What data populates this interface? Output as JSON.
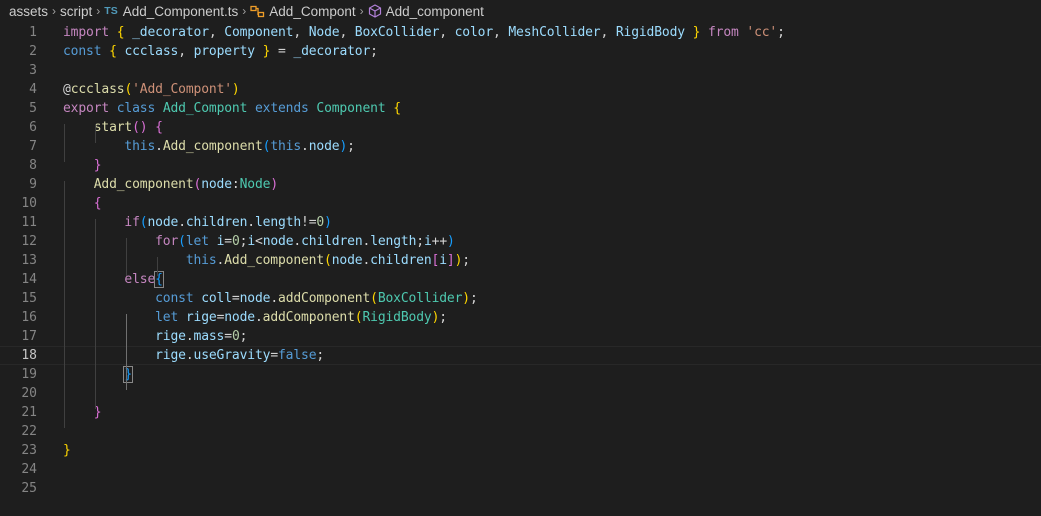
{
  "breadcrumb": {
    "items": [
      "assets",
      "script",
      "Add_Component.ts",
      "Add_Compont",
      "Add_component"
    ],
    "file_badge": "TS"
  },
  "editor": {
    "current_line": 18,
    "lines": [
      {
        "n": "1",
        "tokens": [
          [
            "import",
            "ctl"
          ],
          [
            " "
          ],
          [
            "{",
            "b1"
          ],
          [
            " "
          ],
          [
            "_decorator",
            "var"
          ],
          [
            ", "
          ],
          [
            "Component",
            "var"
          ],
          [
            ", "
          ],
          [
            "Node",
            "var"
          ],
          [
            ", "
          ],
          [
            "BoxCollider",
            "var"
          ],
          [
            ", "
          ],
          [
            "color",
            "var"
          ],
          [
            ", "
          ],
          [
            "MeshCollider",
            "var"
          ],
          [
            ", "
          ],
          [
            "RigidBody",
            "var"
          ],
          [
            " "
          ],
          [
            "}",
            "b1"
          ],
          [
            " "
          ],
          [
            "from",
            "ctl"
          ],
          [
            " "
          ],
          [
            "'cc'",
            "str"
          ],
          [
            ";"
          ]
        ]
      },
      {
        "n": "2",
        "tokens": [
          [
            "const",
            "kw"
          ],
          [
            " "
          ],
          [
            "{",
            "b1"
          ],
          [
            " "
          ],
          [
            "ccclass",
            "var"
          ],
          [
            ", "
          ],
          [
            "property",
            "var"
          ],
          [
            " "
          ],
          [
            "}",
            "b1"
          ],
          [
            " = "
          ],
          [
            "_decorator",
            "var"
          ],
          [
            ";"
          ]
        ]
      },
      {
        "n": "3",
        "tokens": []
      },
      {
        "n": "4",
        "tokens": [
          [
            "@"
          ],
          [
            "ccclass",
            "fn"
          ],
          [
            "(",
            "b1"
          ],
          [
            "'Add_Compont'",
            "str"
          ],
          [
            ")",
            "b1"
          ]
        ]
      },
      {
        "n": "5",
        "tokens": [
          [
            "export",
            "ctl"
          ],
          [
            " "
          ],
          [
            "class",
            "kw"
          ],
          [
            " "
          ],
          [
            "Add_Compont",
            "cls"
          ],
          [
            " "
          ],
          [
            "extends",
            "kw"
          ],
          [
            " "
          ],
          [
            "Component",
            "cls"
          ],
          [
            " "
          ],
          [
            "{",
            "b1"
          ]
        ]
      },
      {
        "n": "6",
        "tokens": [
          [
            "    "
          ],
          [
            "start",
            "fn"
          ],
          [
            "()",
            "b2"
          ],
          [
            " "
          ],
          [
            "{",
            "b2"
          ]
        ]
      },
      {
        "n": "7",
        "tokens": [
          [
            "        "
          ],
          [
            "this",
            "kw"
          ],
          [
            "."
          ],
          [
            "Add_component",
            "fn"
          ],
          [
            "(",
            "b3"
          ],
          [
            "this",
            "kw"
          ],
          [
            "."
          ],
          [
            "node",
            "var"
          ],
          [
            ")",
            "b3"
          ],
          [
            ";"
          ]
        ]
      },
      {
        "n": "8",
        "tokens": [
          [
            "    "
          ],
          [
            "}",
            "b2"
          ]
        ]
      },
      {
        "n": "9",
        "tokens": [
          [
            "    "
          ],
          [
            "Add_component",
            "fn"
          ],
          [
            "(",
            "b2"
          ],
          [
            "node",
            "var"
          ],
          [
            ":"
          ],
          [
            "Node",
            "cls"
          ],
          [
            ")",
            "b2"
          ]
        ]
      },
      {
        "n": "10",
        "tokens": [
          [
            "    "
          ],
          [
            "{",
            "b2"
          ]
        ]
      },
      {
        "n": "11",
        "tokens": [
          [
            "        "
          ],
          [
            "if",
            "ctl"
          ],
          [
            "(",
            "b3"
          ],
          [
            "node",
            "var"
          ],
          [
            "."
          ],
          [
            "children",
            "var"
          ],
          [
            "."
          ],
          [
            "length",
            "var"
          ],
          [
            "!="
          ],
          [
            "0",
            "num"
          ],
          [
            ")",
            "b3"
          ]
        ]
      },
      {
        "n": "12",
        "tokens": [
          [
            "            "
          ],
          [
            "for",
            "ctl"
          ],
          [
            "(",
            "b3"
          ],
          [
            "let",
            "kw"
          ],
          [
            " "
          ],
          [
            "i",
            "var"
          ],
          [
            "="
          ],
          [
            "0",
            "num"
          ],
          [
            ";"
          ],
          [
            "i",
            "var"
          ],
          [
            "<"
          ],
          [
            "node",
            "var"
          ],
          [
            "."
          ],
          [
            "children",
            "var"
          ],
          [
            "."
          ],
          [
            "length",
            "var"
          ],
          [
            ";"
          ],
          [
            "i",
            "var"
          ],
          [
            "++"
          ],
          [
            ")",
            "b3"
          ]
        ]
      },
      {
        "n": "13",
        "tokens": [
          [
            "                "
          ],
          [
            "this",
            "kw"
          ],
          [
            "."
          ],
          [
            "Add_component",
            "fn"
          ],
          [
            "(",
            "b1"
          ],
          [
            "node",
            "var"
          ],
          [
            "."
          ],
          [
            "children",
            "var"
          ],
          [
            "[",
            "b2"
          ],
          [
            "i",
            "var"
          ],
          [
            "]",
            "b2"
          ],
          [
            ")",
            "b1"
          ],
          [
            ";"
          ]
        ]
      },
      {
        "n": "14",
        "tokens": [
          [
            "        "
          ],
          [
            "else",
            "ctl"
          ],
          [
            "{",
            "b3",
            "bm"
          ]
        ]
      },
      {
        "n": "15",
        "tokens": [
          [
            "            "
          ],
          [
            "const",
            "kw"
          ],
          [
            " "
          ],
          [
            "coll",
            "var"
          ],
          [
            "="
          ],
          [
            "node",
            "var"
          ],
          [
            "."
          ],
          [
            "addComponent",
            "fn"
          ],
          [
            "(",
            "b1"
          ],
          [
            "BoxCollider",
            "cls"
          ],
          [
            ")",
            "b1"
          ],
          [
            ";"
          ]
        ]
      },
      {
        "n": "16",
        "tokens": [
          [
            "            "
          ],
          [
            "let",
            "kw"
          ],
          [
            " "
          ],
          [
            "rige",
            "var"
          ],
          [
            "="
          ],
          [
            "node",
            "var"
          ],
          [
            "."
          ],
          [
            "addComponent",
            "fn"
          ],
          [
            "(",
            "b1"
          ],
          [
            "RigidBody",
            "cls"
          ],
          [
            ")",
            "b1"
          ],
          [
            ";"
          ]
        ]
      },
      {
        "n": "17",
        "tokens": [
          [
            "            "
          ],
          [
            "rige",
            "var"
          ],
          [
            "."
          ],
          [
            "mass",
            "var"
          ],
          [
            "="
          ],
          [
            "0",
            "num"
          ],
          [
            ";"
          ]
        ]
      },
      {
        "n": "18",
        "tokens": [
          [
            "            "
          ],
          [
            "rige",
            "var"
          ],
          [
            "."
          ],
          [
            "useGravity",
            "var"
          ],
          [
            "="
          ],
          [
            "false",
            "kw"
          ],
          [
            ";"
          ]
        ]
      },
      {
        "n": "19",
        "tokens": [
          [
            "        "
          ],
          [
            "}",
            "b3",
            "bm"
          ]
        ]
      },
      {
        "n": "20",
        "tokens": []
      },
      {
        "n": "21",
        "tokens": [
          [
            "    "
          ],
          [
            "}",
            "b2"
          ]
        ]
      },
      {
        "n": "22",
        "tokens": []
      },
      {
        "n": "23",
        "tokens": [
          [
            "}",
            "b1"
          ]
        ]
      },
      {
        "n": "24",
        "tokens": []
      },
      {
        "n": "25",
        "tokens": []
      }
    ]
  }
}
